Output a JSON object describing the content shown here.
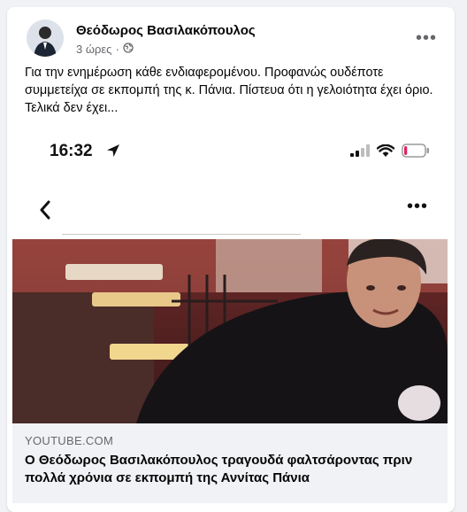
{
  "post": {
    "author": "Θεόδωρος Βασιλακόπουλος",
    "time": "3 ώρες",
    "privacy_icon": "globe-icon",
    "text": "Για την ενημέρωση κάθε ενδιαφερομένου. Προφανώς ουδέποτε συμμετείχα σε εκπομπή της κ. Πάνια. Πίστευα ότι η γελοιότητα έχει όριο. Τελικά δεν έχει..."
  },
  "screenshot": {
    "time": "16:32",
    "battery_level": 0.15
  },
  "link": {
    "source": "YOUTUBE.COM",
    "title": "Ο Θεόδωρος Βασιλακόπουλος τραγουδά φαλτσάροντας πριν πολλά χρόνια σε εκπομπή της Αννίτας Πάνια"
  },
  "colors": {
    "author_text": "#050505",
    "meta_text": "#65676b",
    "battery_low": "#e0245e",
    "card_bg": "#ffffff",
    "page_bg": "#f0f2f5"
  }
}
